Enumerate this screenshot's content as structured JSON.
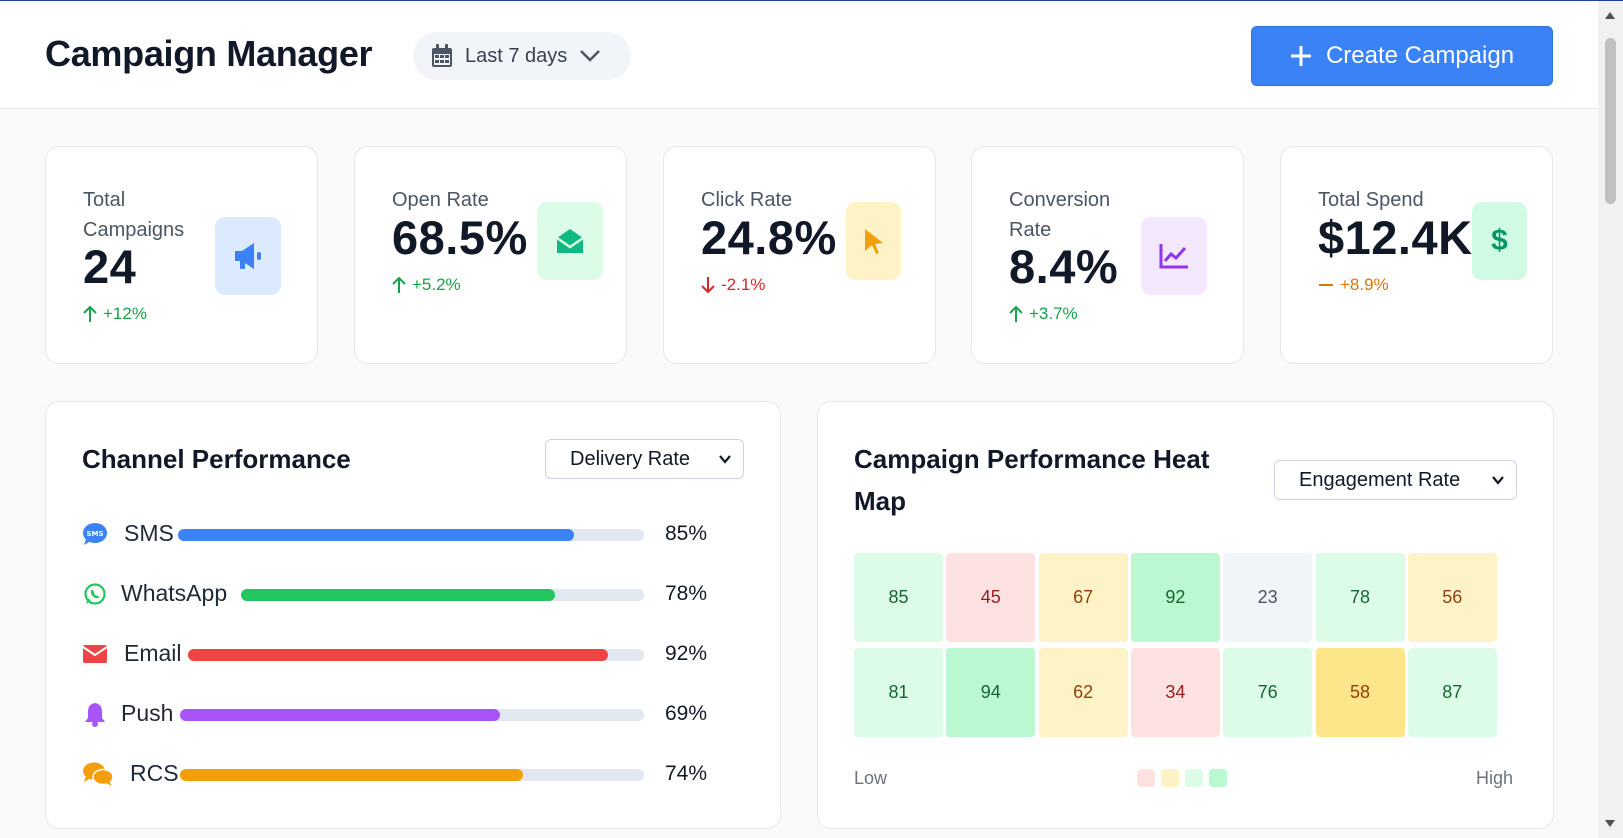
{
  "header": {
    "title": "Campaign Manager",
    "date_range": "Last 7 days",
    "create_button": "Create Campaign"
  },
  "stats": [
    {
      "label": "Total Campaigns",
      "value": "24",
      "change": "+12%",
      "trend": "up",
      "icon": "megaphone-icon",
      "icon_color": "#3b82f6",
      "icon_bg": "#dbeafe"
    },
    {
      "label": "Open Rate",
      "value": "68.5%",
      "change": "+5.2%",
      "trend": "up",
      "icon": "envelope-open-icon",
      "icon_color": "#10b981",
      "icon_bg": "#dcfce7"
    },
    {
      "label": "Click Rate",
      "value": "24.8%",
      "change": "-2.1%",
      "trend": "down",
      "icon": "cursor-icon",
      "icon_color": "#f59e0b",
      "icon_bg": "#fef3c7"
    },
    {
      "label": "Conversion Rate",
      "value": "8.4%",
      "change": "+3.7%",
      "trend": "up",
      "icon": "chart-line-icon",
      "icon_color": "#9333ea",
      "icon_bg": "#f3e8ff"
    },
    {
      "label": "Total Spend",
      "value": "$12.4K",
      "change": "+8.9%",
      "trend": "flat",
      "icon": "dollar-icon",
      "icon_color": "#059669",
      "icon_bg": "#d1fae5"
    }
  ],
  "channel_performance": {
    "title": "Channel Performance",
    "metric_select": "Delivery Rate",
    "channels": [
      {
        "name": "SMS",
        "value": 85,
        "label": "85%",
        "color": "#3b82f6",
        "icon": "sms-icon"
      },
      {
        "name": "WhatsApp",
        "value": 78,
        "label": "78%",
        "color": "#22c55e",
        "icon": "whatsapp-icon"
      },
      {
        "name": "Email",
        "value": 92,
        "label": "92%",
        "color": "#ef4444",
        "icon": "mail-icon"
      },
      {
        "name": "Push",
        "value": 69,
        "label": "69%",
        "color": "#a855f7",
        "icon": "bell-icon"
      },
      {
        "name": "RCS",
        "value": 74,
        "label": "74%",
        "color": "#f59e0b",
        "icon": "chat-bubbles-icon"
      }
    ]
  },
  "heatmap": {
    "title": "Campaign Performance Heat Map",
    "metric_select": "Engagement Rate",
    "rows": [
      [
        85,
        45,
        67,
        92,
        23,
        78,
        56
      ],
      [
        81,
        94,
        62,
        34,
        76,
        58,
        87
      ]
    ],
    "cell_styles": [
      [
        {
          "bg": "#dcfce7",
          "fg": "#166534"
        },
        {
          "bg": "#fee2e2",
          "fg": "#991b1b"
        },
        {
          "bg": "#fef3c7",
          "fg": "#92400e"
        },
        {
          "bg": "#bbf7d0",
          "fg": "#166534"
        },
        {
          "bg": "#f1f5f9",
          "fg": "#475569"
        },
        {
          "bg": "#dcfce7",
          "fg": "#166534"
        },
        {
          "bg": "#fef3c7",
          "fg": "#92400e"
        }
      ],
      [
        {
          "bg": "#dcfce7",
          "fg": "#166534"
        },
        {
          "bg": "#bbf7d0",
          "fg": "#166534"
        },
        {
          "bg": "#fef3c7",
          "fg": "#92400e"
        },
        {
          "bg": "#fee2e2",
          "fg": "#991b1b"
        },
        {
          "bg": "#dcfce7",
          "fg": "#166534"
        },
        {
          "bg": "#fde68a",
          "fg": "#92400e"
        },
        {
          "bg": "#dcfce7",
          "fg": "#166534"
        }
      ]
    ],
    "legend_low": "Low",
    "legend_high": "High",
    "legend_colors": [
      "#fee2e2",
      "#fef3c7",
      "#dcfce7",
      "#bbf7d0"
    ]
  }
}
